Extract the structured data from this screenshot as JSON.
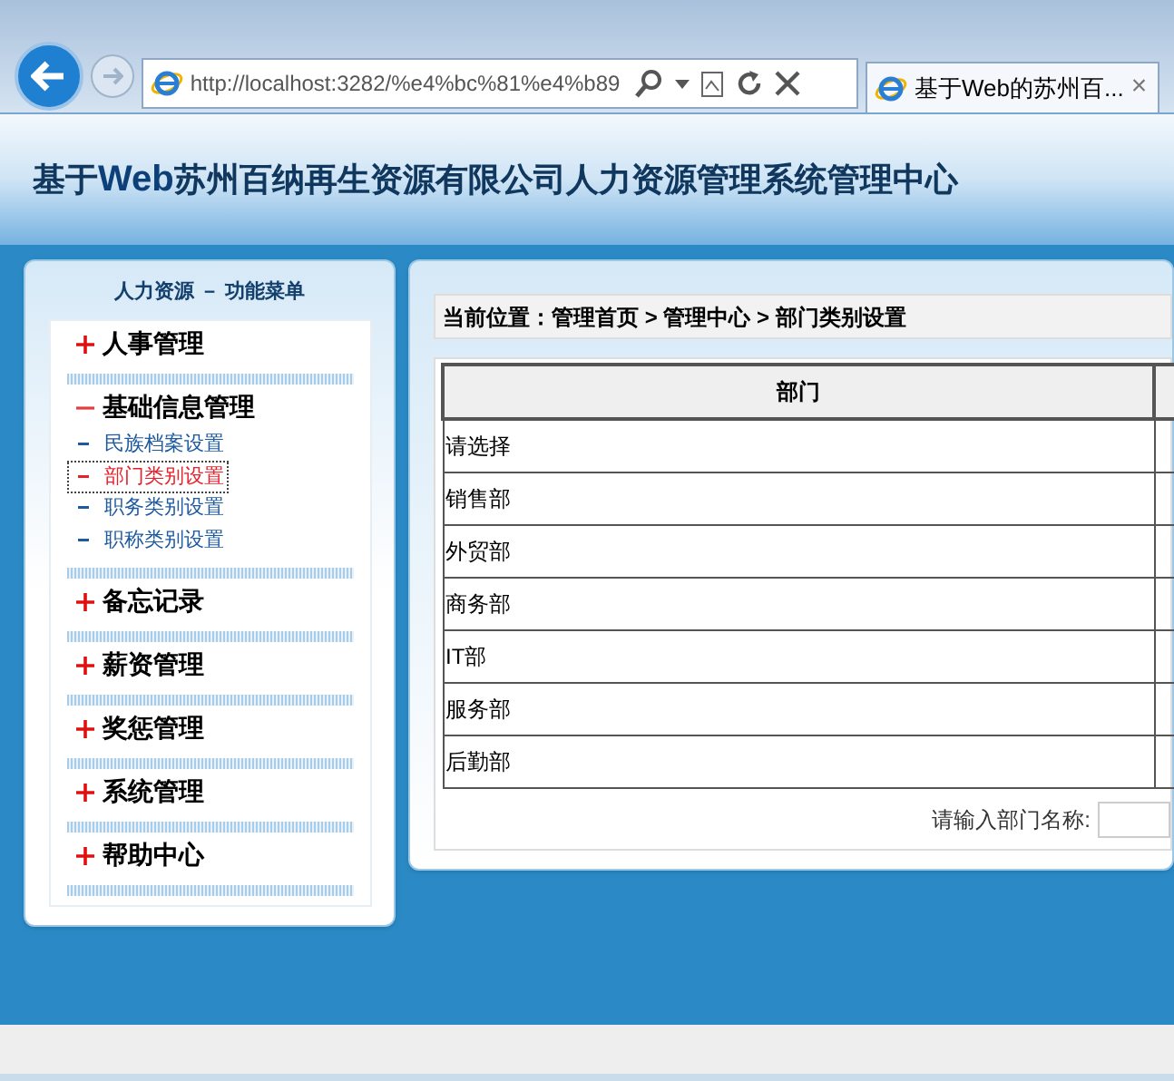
{
  "browser": {
    "address": "http://localhost:3282/%e4%bc%81%e4%b89",
    "tab_title": "基于Web的苏州百...",
    "tab_close": "×"
  },
  "header": {
    "title": "基于**Web**苏州百纳再生资源有限公司人力资源管理系统管理中心"
  },
  "sidebar": {
    "title": "人力资源 － 功能菜单",
    "groups": [
      {
        "label": "人事管理",
        "expanded": false
      },
      {
        "label": "基础信息管理",
        "expanded": true,
        "children": [
          {
            "label": "民族档案设置",
            "selected": false
          },
          {
            "label": "部门类别设置",
            "selected": true
          },
          {
            "label": "职务类别设置",
            "selected": false
          },
          {
            "label": "职称类别设置",
            "selected": false
          }
        ]
      },
      {
        "label": "备忘记录",
        "expanded": false
      },
      {
        "label": "薪资管理",
        "expanded": false
      },
      {
        "label": "奖惩管理",
        "expanded": false
      },
      {
        "label": "系统管理",
        "expanded": false
      },
      {
        "label": "帮助中心",
        "expanded": false
      }
    ]
  },
  "main": {
    "breadcrumb": "当前位置：管理首页 > 管理中心 > 部门类别设置",
    "table": {
      "columns": [
        "部门"
      ],
      "rows": [
        "请选择",
        "销售部",
        "外贸部",
        "商务部",
        "IT部",
        "服务部",
        "后勤部"
      ]
    },
    "search": {
      "label": "请输入部门名称:"
    }
  }
}
